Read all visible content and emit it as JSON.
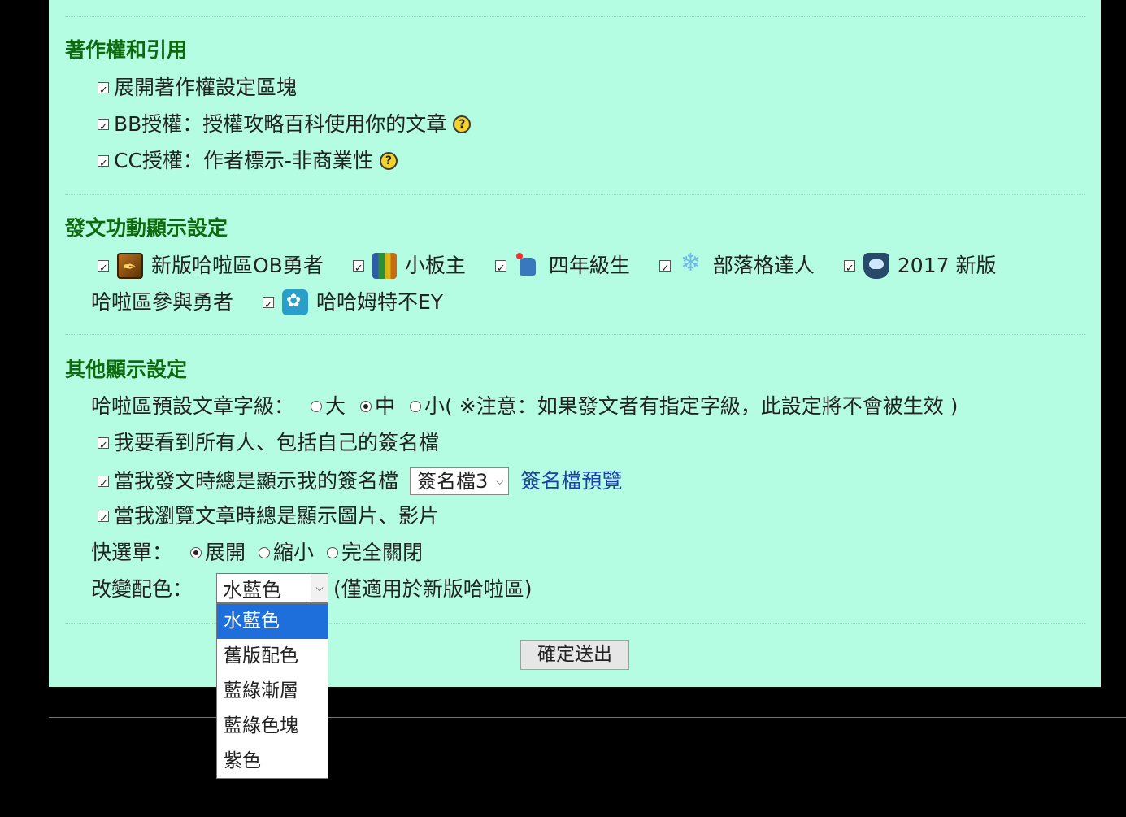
{
  "copyright": {
    "title": "著作權和引用",
    "items": [
      {
        "label": "展開著作權設定區塊"
      },
      {
        "label": "BB授權：授權攻略百科使用你的文章"
      },
      {
        "label": "CC授權：作者標示-非商業性"
      }
    ],
    "help_icon_text": "?"
  },
  "badges": {
    "title": "發文功動顯示設定",
    "items": [
      {
        "label": "新版哈啦區OB勇者",
        "icon": "quill-badge-icon"
      },
      {
        "label": "小板主",
        "icon": "books-badge-icon"
      },
      {
        "label": "四年級生",
        "icon": "character-badge-icon"
      },
      {
        "label": "部落格達人",
        "icon": "snowflake-medal-icon"
      },
      {
        "label": "2017 新版",
        "icon": "chat-shield-icon"
      },
      {
        "label": "哈啦區參與勇者",
        "icon": ""
      },
      {
        "label": "哈哈姆特不EY",
        "icon": "flower-badge-icon"
      }
    ]
  },
  "other": {
    "title": "其他顯示設定",
    "font_size_label": "哈啦區預設文章字級：",
    "font_size_options": [
      "大",
      "中",
      "小"
    ],
    "font_size_selected": "中",
    "font_size_note": "( ※注意：如果發文者有指定字級，此設定將不會被生效 )",
    "show_all_signatures": "我要看到所有人、包括自己的簽名檔",
    "always_show_signature": "當我發文時總是顯示我的簽名檔",
    "signature_select_value": "簽名檔3",
    "signature_preview_link": "簽名檔預覽",
    "always_show_media": "當我瀏覽文章時總是顯示圖片、影片",
    "quick_menu_label": "快選單：",
    "quick_menu_options": [
      "展開",
      "縮小",
      "完全關閉"
    ],
    "quick_menu_selected": "展開",
    "color_label": "改變配色：",
    "color_selected": "水藍色",
    "color_note": "(僅適用於新版哈啦區)",
    "color_options": [
      "水藍色",
      "舊版配色",
      "藍綠漸層",
      "藍綠色塊",
      "紫色"
    ]
  },
  "submit_label": "確定送出",
  "colors": {
    "panel_bg": "#b5fde2",
    "title_green": "#0e6a0e",
    "link_blue": "#1a3fa6",
    "dropdown_highlight": "#1e6fdb"
  }
}
